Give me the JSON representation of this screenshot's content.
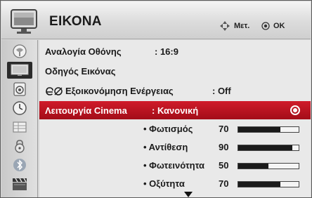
{
  "header": {
    "title": "ΕΙΚΟΝΑ",
    "nav_hint": "Μετ.",
    "ok_hint": "OK"
  },
  "sidebar": {
    "items": [
      {
        "icon": "satellite-dish-icon"
      },
      {
        "icon": "tv-picture-icon",
        "active": true
      },
      {
        "icon": "speaker-audio-icon"
      },
      {
        "icon": "clock-time-icon"
      },
      {
        "icon": "options-grid-icon"
      },
      {
        "icon": "lock-icon"
      },
      {
        "icon": "bluetooth-icon"
      },
      {
        "icon": "clapperboard-icon"
      }
    ]
  },
  "menu": {
    "aspect_label": "Αναλογία Οθόνης",
    "aspect_value": ": 16:9",
    "wizard_label": "Οδηγός Εικόνας",
    "energy_label": "Εξοικονόμηση Ενέργειας",
    "energy_value": ": Off",
    "mode_label": "Λειτουργία Cinema",
    "mode_value": ": Κανονική",
    "settings": [
      {
        "label": "• Φωτισμός",
        "value": "70",
        "level": 70
      },
      {
        "label": "• Αντίθεση",
        "value": "90",
        "level": 90
      },
      {
        "label": "• Φωτεινότητα",
        "value": "50",
        "level": 50
      },
      {
        "label": "• Οξύτητα",
        "value": "70",
        "level": 70
      }
    ]
  },
  "colors": {
    "accent": "#c8141f",
    "bar_fill": "#1a1a1a"
  }
}
